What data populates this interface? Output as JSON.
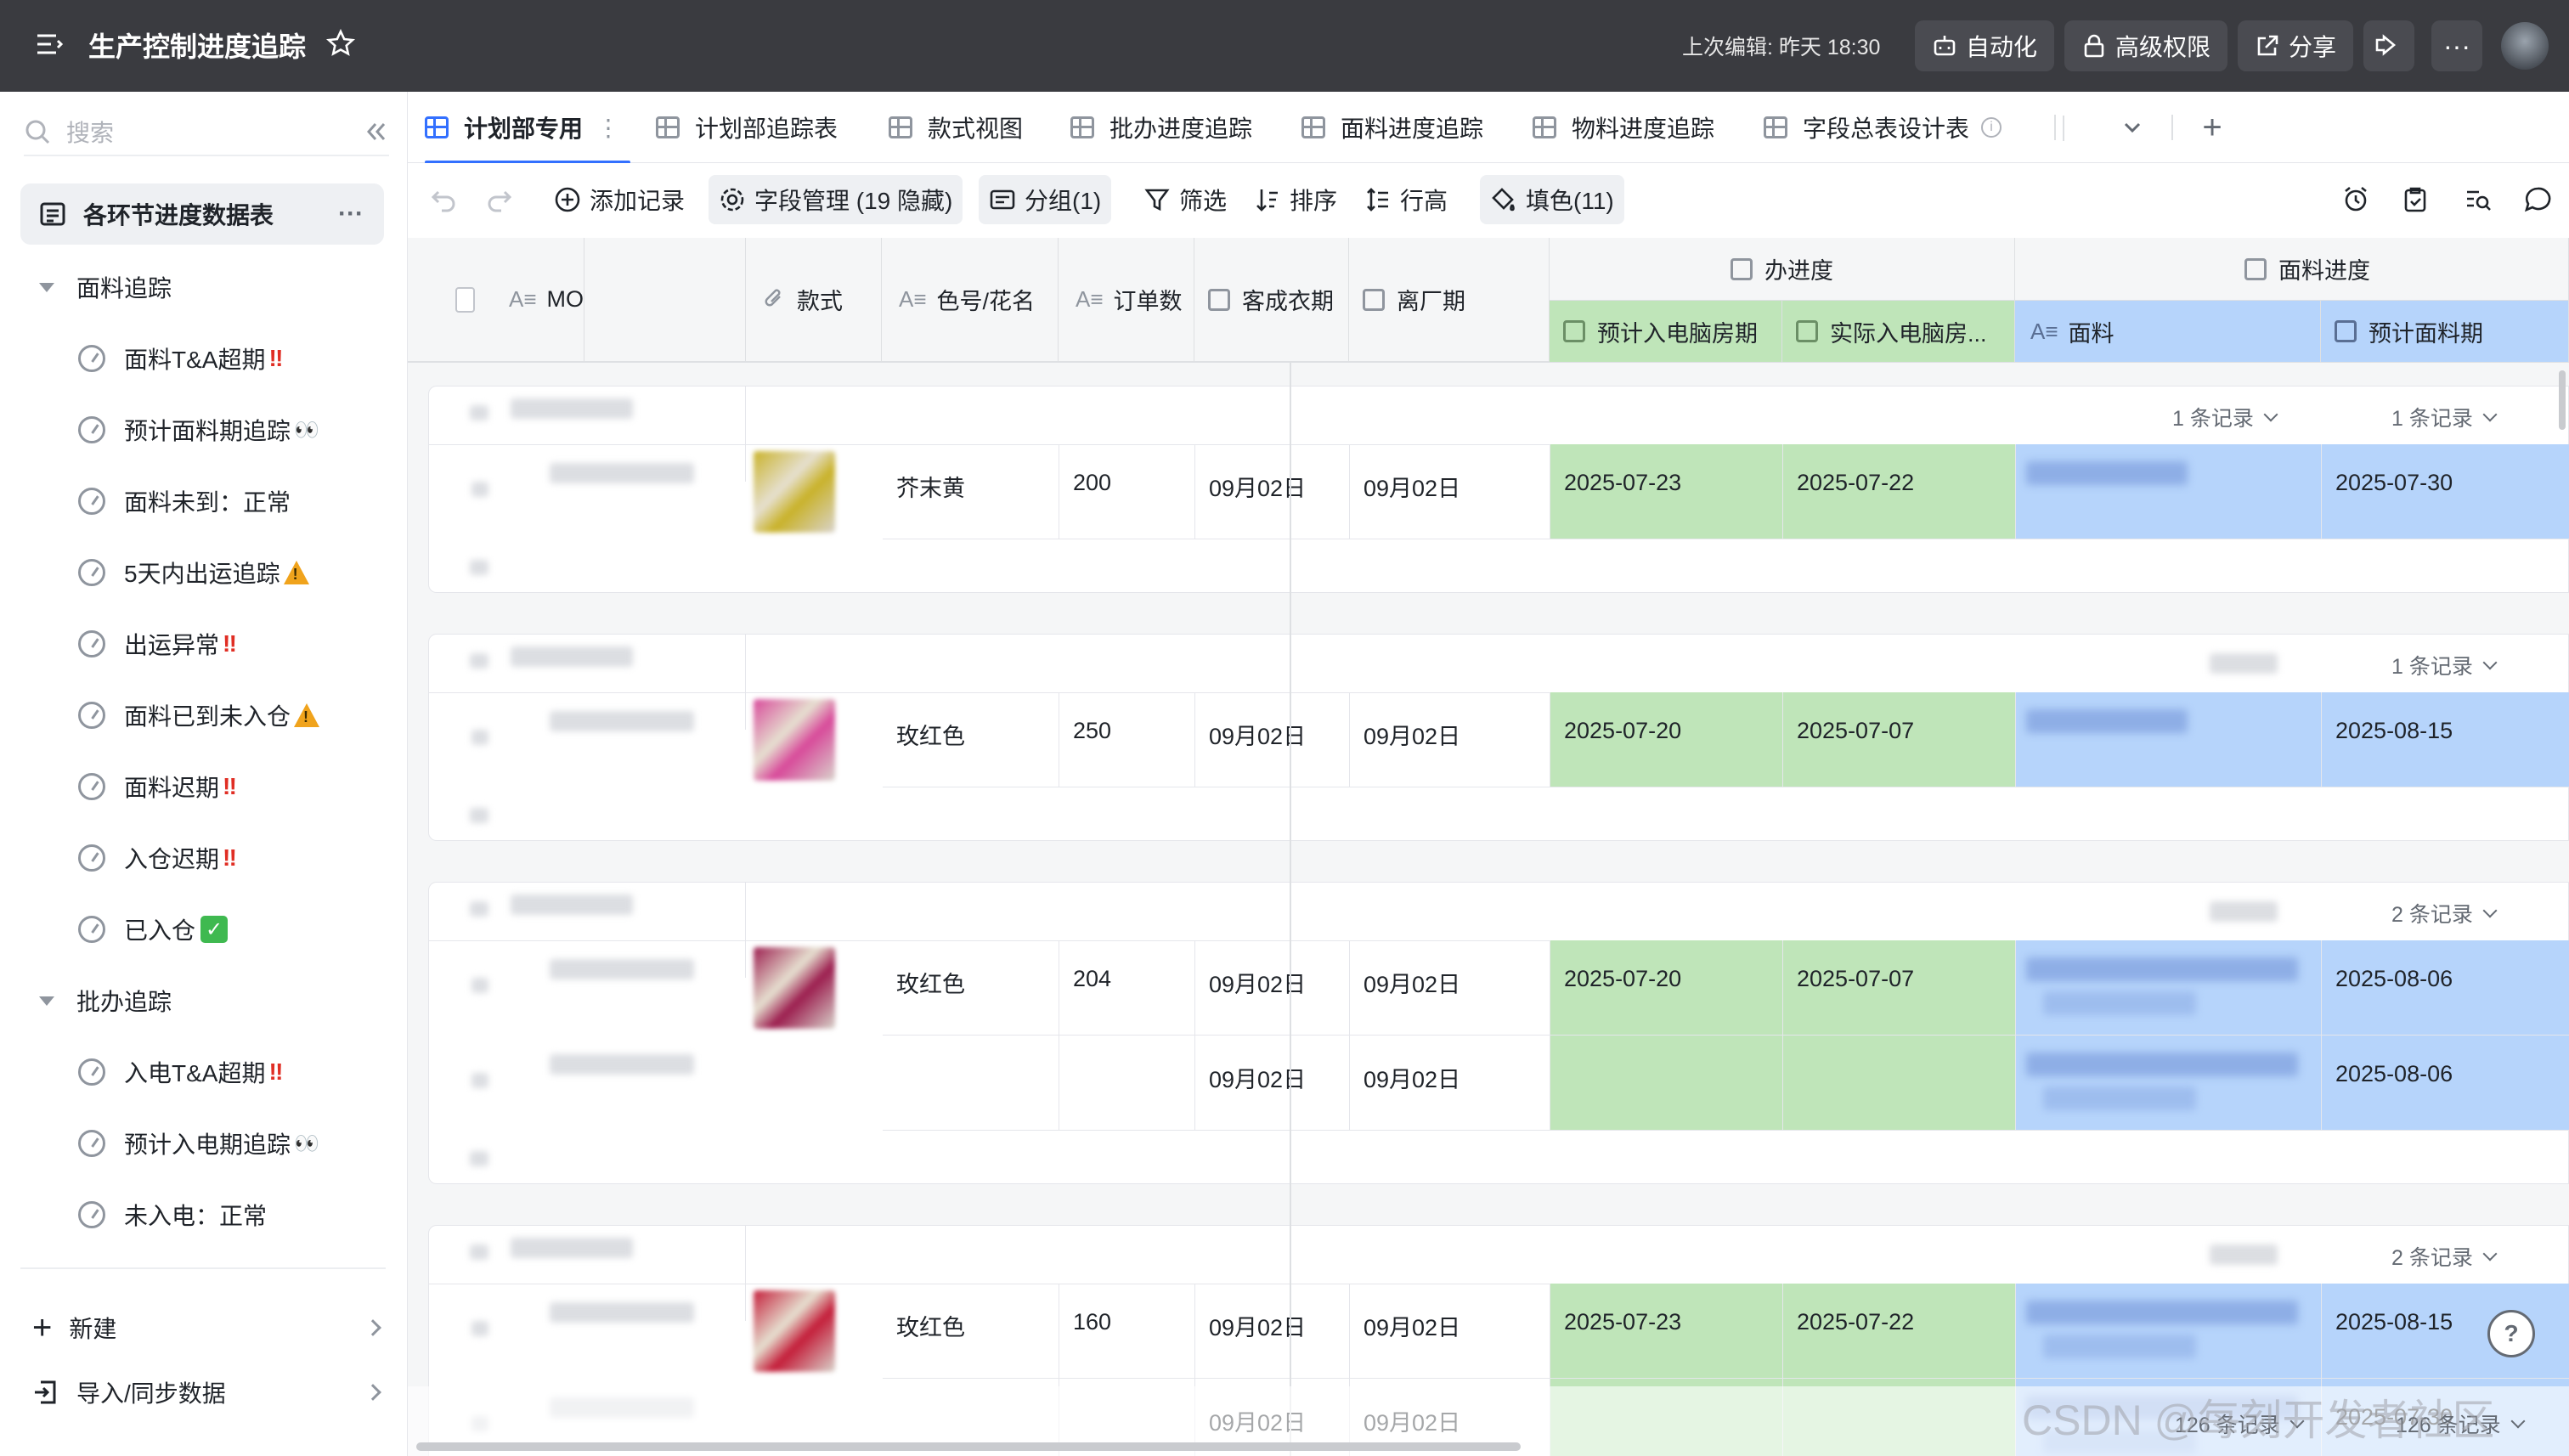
{
  "topbar": {
    "title": "生产控制进度追踪",
    "last_edit": "上次编辑: 昨天 18:30",
    "automation": "自动化",
    "permission": "高级权限",
    "share": "分享"
  },
  "sidebar": {
    "search_placeholder": "搜索",
    "main_table": "各环节进度数据表",
    "groups": [
      {
        "label": "面料追踪",
        "views": [
          {
            "label": "面料T&A超期",
            "mark": "!!"
          },
          {
            "label": "预计面料期追踪",
            "mark": "eyes"
          },
          {
            "label": "面料未到：正常",
            "mark": ""
          },
          {
            "label": "5天内出运追踪",
            "mark": "warn"
          },
          {
            "label": "出运异常",
            "mark": "!!"
          },
          {
            "label": "面料已到未入仓",
            "mark": "warn"
          },
          {
            "label": "面料迟期",
            "mark": "!!"
          },
          {
            "label": "入仓迟期",
            "mark": "!!"
          },
          {
            "label": "已入仓",
            "mark": "check"
          }
        ]
      },
      {
        "label": "批办追踪",
        "views": [
          {
            "label": "入电T&A超期",
            "mark": "!!"
          },
          {
            "label": "预计入电期追踪",
            "mark": "eyes"
          },
          {
            "label": "未入电：正常",
            "mark": ""
          }
        ]
      }
    ],
    "new_label": "新建",
    "import_label": "导入/同步数据"
  },
  "tabs": [
    "计划部专用",
    "计划部追踪表",
    "款式视图",
    "批办进度追踪",
    "面料进度追踪",
    "物料进度追踪",
    "字段总表设计表"
  ],
  "toolbar": {
    "add_record": "添加记录",
    "field_manage": "字段管理 (19 隐藏)",
    "group": "分组(1)",
    "filter": "筛选",
    "sort": "排序",
    "row_height": "行高",
    "fill": "填色(11)"
  },
  "columns": {
    "mo": "MO",
    "style": "款式",
    "color": "色号/花名",
    "qty": "订单数",
    "customer_date": "客成衣期",
    "exit_date": "离厂期",
    "group_batch": "办进度",
    "est_pc": "预计入电脑房期",
    "act_pc": "实际入电脑房...",
    "group_fabric": "面料进度",
    "fabric": "面料",
    "est_fabric": "预计面料期"
  },
  "colors": {
    "green": "#bfe5b9",
    "blue": "#b6d4fb",
    "accent": "#3370ff"
  },
  "groups": [
    {
      "count_a": "1 条记录",
      "count_b": "1 条记录",
      "swatch": "#c9b22a",
      "rows": [
        {
          "color": "芥末黄",
          "qty": "200",
          "cust": "09月02日",
          "exit": "09月02日",
          "est_pc": "2025-07-23",
          "act_pc": "2025-07-22",
          "est_fabric": "2025-07-30"
        }
      ]
    },
    {
      "count_a": "",
      "count_b": "1 条记录",
      "swatch": "#d84a9a",
      "rows": [
        {
          "color": "玫红色",
          "qty": "250",
          "cust": "09月02日",
          "exit": "09月02日",
          "est_pc": "2025-07-20",
          "act_pc": "2025-07-07",
          "est_fabric": "2025-08-15"
        }
      ]
    },
    {
      "count_a": "",
      "count_b": "2 条记录",
      "swatch": "#9c1e4f",
      "rows": [
        {
          "color": "玫红色",
          "qty": "204",
          "cust": "09月02日",
          "exit": "09月02日",
          "est_pc": "2025-07-20",
          "act_pc": "2025-07-07",
          "est_fabric": "2025-08-06"
        },
        {
          "color": "",
          "qty": "",
          "cust": "09月02日",
          "exit": "09月02日",
          "est_pc": "",
          "act_pc": "",
          "est_fabric": "2025-08-06"
        }
      ]
    },
    {
      "count_a": "",
      "count_b": "2 条记录",
      "swatch": "#c41e3a",
      "rows": [
        {
          "color": "玫红色",
          "qty": "160",
          "cust": "09月02日",
          "exit": "09月02日",
          "est_pc": "2025-07-23",
          "act_pc": "2025-07-22",
          "est_fabric": "2025-08-15"
        },
        {
          "color": "",
          "qty": "",
          "cust": "09月02日",
          "exit": "09月02日",
          "est_pc": "",
          "act_pc": "",
          "est_fabric": "2025-07-30"
        }
      ]
    }
  ],
  "footer": {
    "total_a": "126 条记录",
    "total_b": "126 条记录"
  },
  "watermark": "CSDN @每刻开发者社区"
}
